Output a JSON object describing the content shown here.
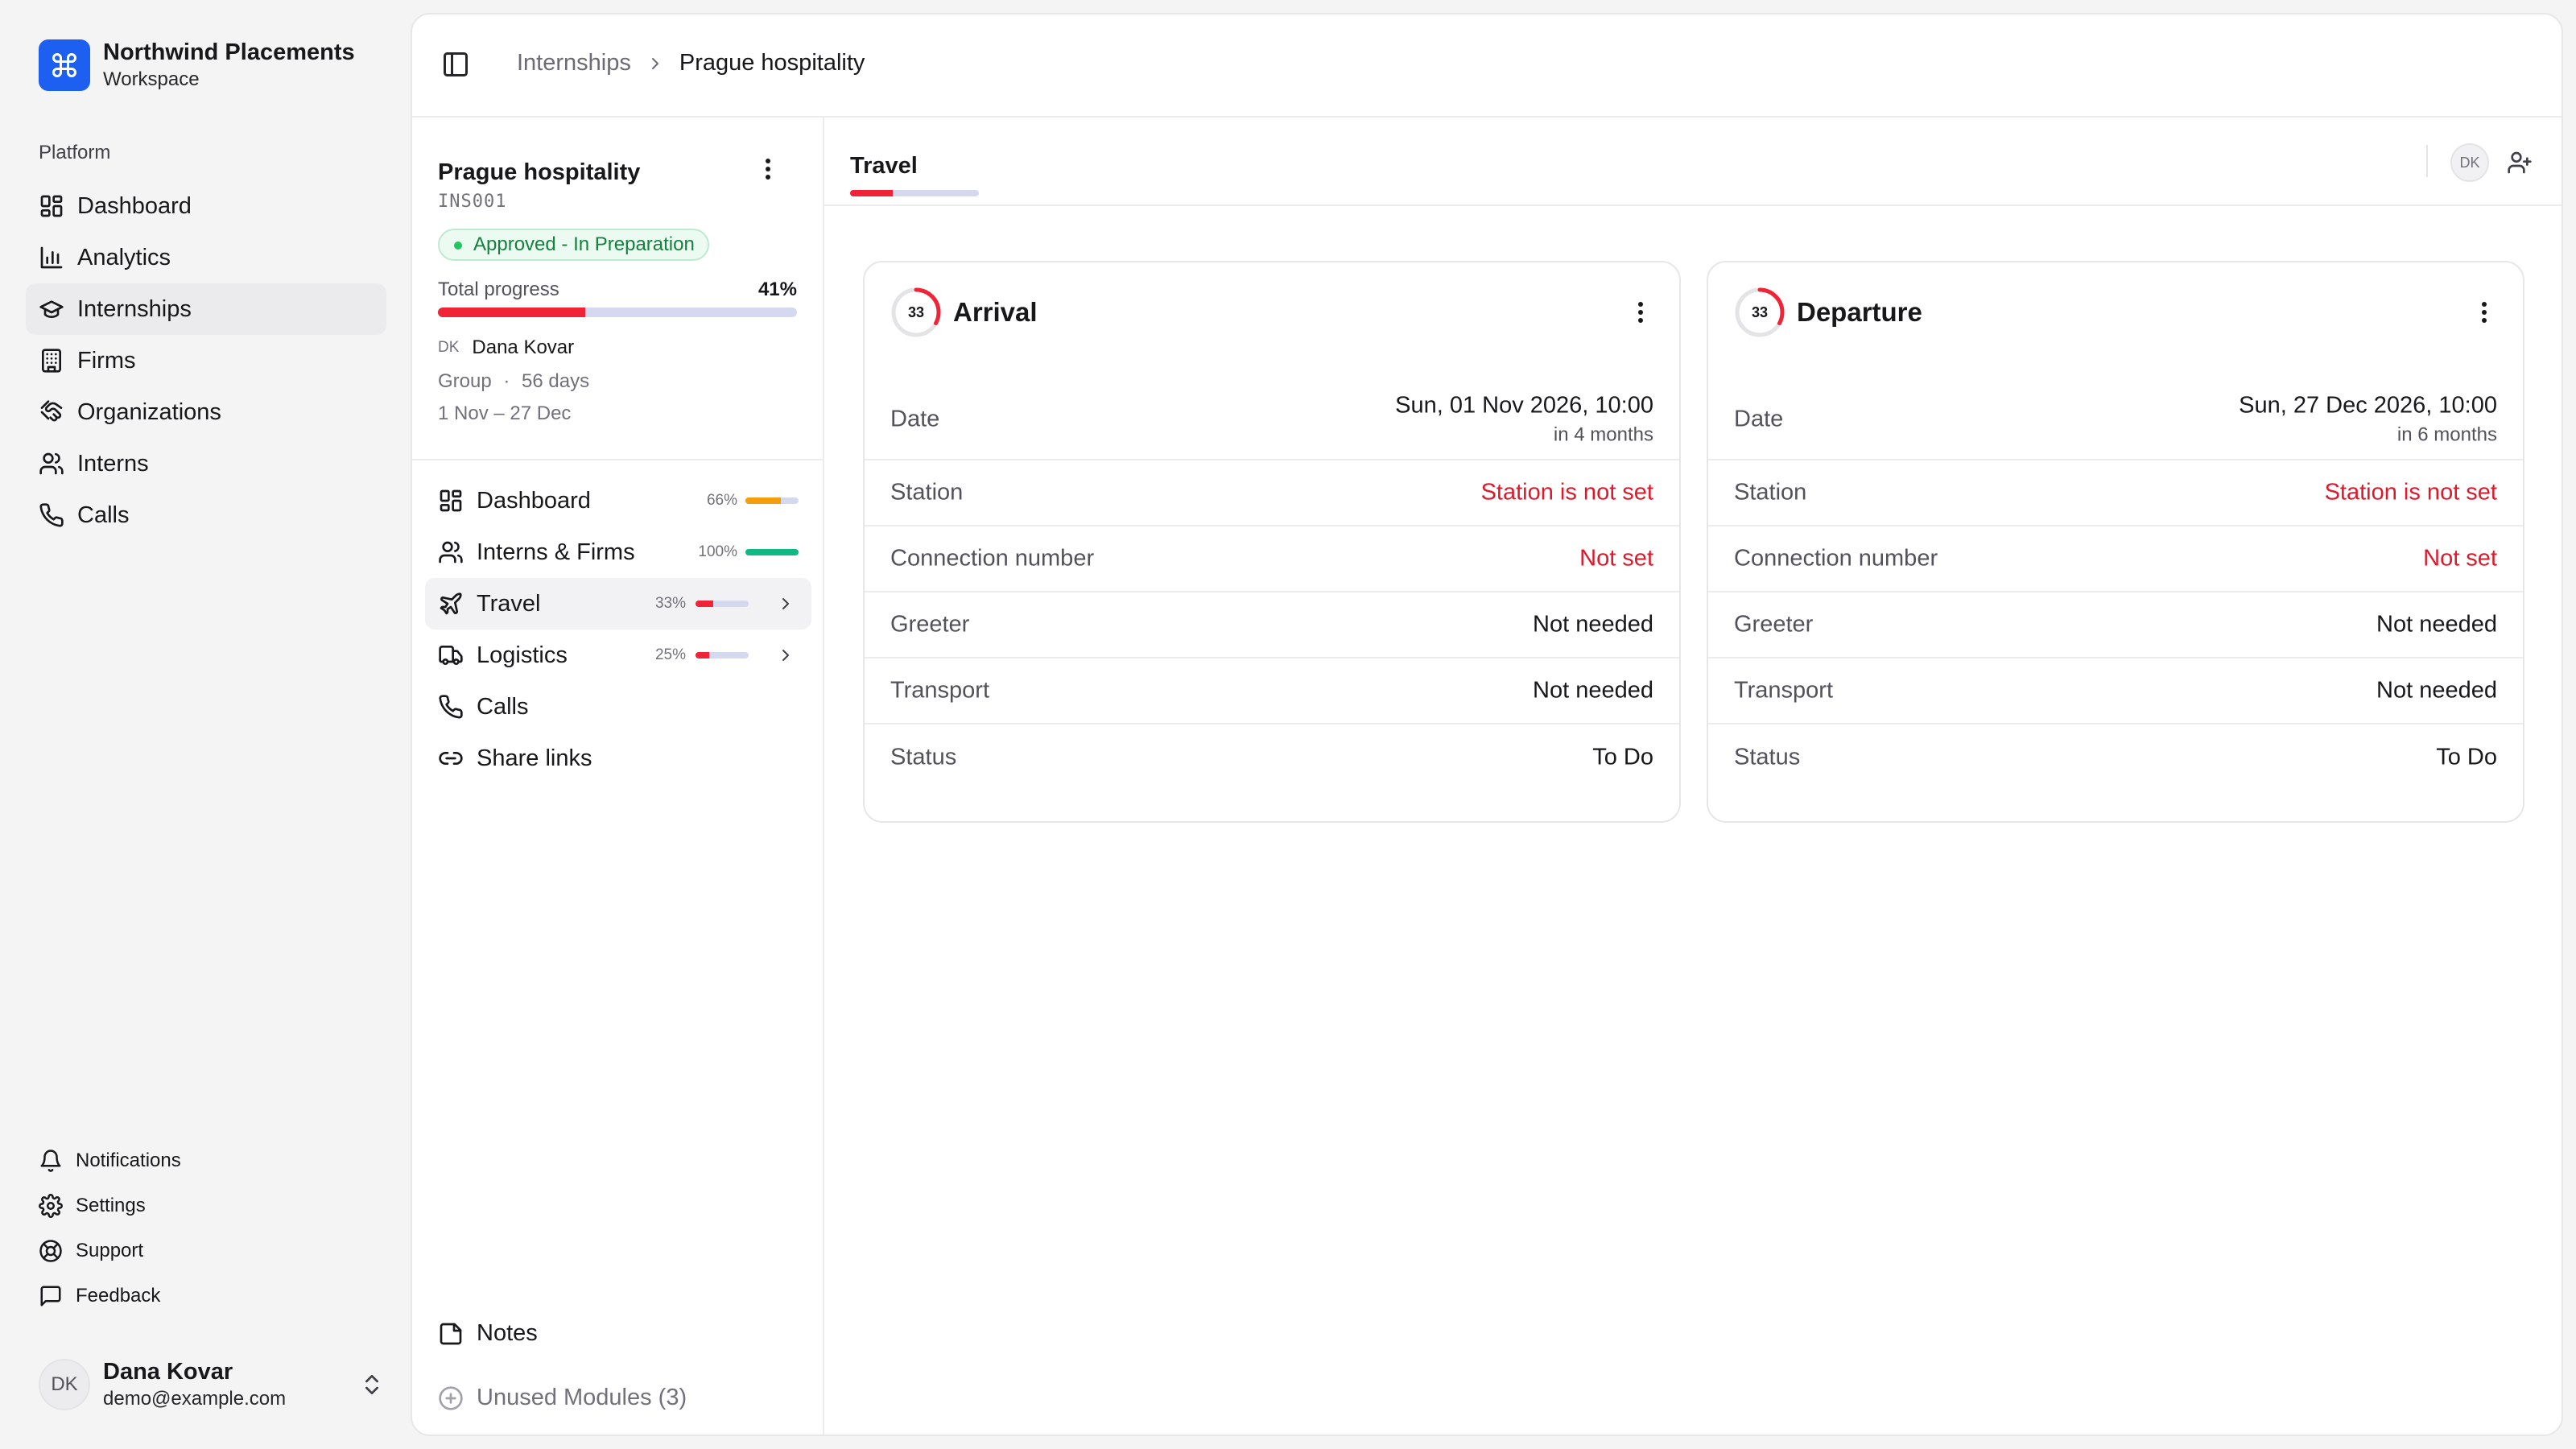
{
  "brand": {
    "name": "Northwind Placements",
    "subtitle": "Workspace",
    "icon": "command-icon",
    "color": "#1d5ff0"
  },
  "sidebar": {
    "group_label": "Platform",
    "items": [
      {
        "label": "Dashboard",
        "icon": "dashboard-icon"
      },
      {
        "label": "Analytics",
        "icon": "bar-chart-icon"
      },
      {
        "label": "Internships",
        "icon": "graduation-cap-icon",
        "active": true
      },
      {
        "label": "Firms",
        "icon": "building-icon"
      },
      {
        "label": "Organizations",
        "icon": "handshake-icon"
      },
      {
        "label": "Interns",
        "icon": "users-icon"
      },
      {
        "label": "Calls",
        "icon": "phone-icon"
      }
    ],
    "footer_items": [
      {
        "label": "Notifications",
        "icon": "bell-icon"
      },
      {
        "label": "Settings",
        "icon": "gear-icon"
      },
      {
        "label": "Support",
        "icon": "lifebuoy-icon"
      },
      {
        "label": "Feedback",
        "icon": "message-icon"
      }
    ],
    "user": {
      "initials": "DK",
      "name": "Dana Kovar",
      "email": "demo@example.com"
    }
  },
  "breadcrumb": {
    "parent": "Internships",
    "current": "Prague hospitality"
  },
  "project": {
    "title": "Prague hospitality",
    "code": "INS001",
    "status": "Approved - In Preparation",
    "progress_label": "Total progress",
    "progress_text": "41%",
    "progress": 0.41,
    "owner_initials": "DK",
    "owner_name": "Dana Kovar",
    "meta_type": "Group",
    "meta_sep": "·",
    "meta_duration": "56 days",
    "meta_range": "1 Nov – 27 Dec"
  },
  "modules": [
    {
      "label": "Dashboard",
      "icon": "dashboard-icon",
      "pct_text": "66%",
      "pct": 0.66,
      "color": "#f59e0b"
    },
    {
      "label": "Interns & Firms",
      "icon": "users-icon",
      "pct_text": "100%",
      "pct": 1.0,
      "color": "#10b981"
    },
    {
      "label": "Travel",
      "icon": "plane-icon",
      "pct_text": "33%",
      "pct": 0.33,
      "color": "#ef2437",
      "active": true,
      "chevron": true
    },
    {
      "label": "Logistics",
      "icon": "truck-icon",
      "pct_text": "25%",
      "pct": 0.25,
      "color": "#ef2437",
      "chevron": true
    },
    {
      "label": "Calls",
      "icon": "phone-icon"
    },
    {
      "label": "Share links",
      "icon": "link-icon"
    }
  ],
  "notes_label": "Notes",
  "unused_label": "Unused Modules (3)",
  "tab": {
    "title": "Travel",
    "progress": 0.33,
    "avatar": "DK"
  },
  "cards": [
    {
      "title": "Arrival",
      "ring_value": "33",
      "ring_pct": 0.33,
      "rows": [
        {
          "label": "Date",
          "value": "Sun, 01 Nov 2026, 10:00",
          "sub": "in 4 months"
        },
        {
          "label": "Station",
          "value": "Station is not set",
          "warn": true
        },
        {
          "label": "Connection number",
          "value": "Not set",
          "warn": true
        },
        {
          "label": "Greeter",
          "value": "Not needed"
        },
        {
          "label": "Transport",
          "value": "Not needed"
        },
        {
          "label": "Status",
          "value": "To Do"
        }
      ]
    },
    {
      "title": "Departure",
      "ring_value": "33",
      "ring_pct": 0.33,
      "rows": [
        {
          "label": "Date",
          "value": "Sun, 27 Dec 2026, 10:00",
          "sub": "in 6 months"
        },
        {
          "label": "Station",
          "value": "Station is not set",
          "warn": true
        },
        {
          "label": "Connection number",
          "value": "Not set",
          "warn": true
        },
        {
          "label": "Greeter",
          "value": "Not needed"
        },
        {
          "label": "Transport",
          "value": "Not needed"
        },
        {
          "label": "Status",
          "value": "To Do"
        }
      ]
    }
  ],
  "colors": {
    "accent_red": "#ef2437",
    "warn_text": "#dc1a2c",
    "track": "#d4d9f0",
    "success": "#22c55e"
  }
}
